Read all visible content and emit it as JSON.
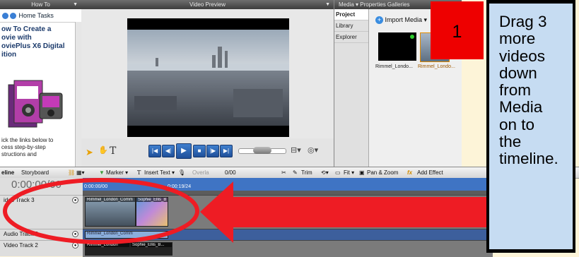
{
  "howto": {
    "title": "How To",
    "nav": "Home  Tasks",
    "heading_lines": [
      "ow To Create a",
      "ovie with",
      "oviePlus X6 Digital",
      "ition"
    ],
    "body_lines": [
      "ick the links below to",
      "cess step-by-step",
      "structions and"
    ]
  },
  "preview": {
    "title": "Video Preview"
  },
  "media": {
    "tabs": "Media ▾  Properties  Galleries",
    "side_items": [
      "Project",
      "Library",
      "Explorer"
    ],
    "import_label": "Import Media ▾",
    "thumb1_label": "Rimmel_Londo...",
    "thumb2_label": "Rimmel_Londo..."
  },
  "timeline": {
    "tab_timeline": "eline",
    "tab_storyboard": "Storyboard",
    "marker": "Marker ▾",
    "insert_text": "Insert Text ▾",
    "overlay": "Overla",
    "overlay_time": "0/00",
    "trim": "Trim",
    "fit": "Fit ▾",
    "pan_zoom": "Pan & Zoom",
    "add_effect": "Add Effect",
    "timecode": "0:00:00/00",
    "ruler_start": "0:00:00/00",
    "ruler_mark": "0:00:19/24",
    "tracks": [
      {
        "name": "ideo Track 3"
      },
      {
        "name": "Audio Track 3"
      },
      {
        "name": "Video Track 2"
      }
    ],
    "clip_a": "Rimmel_London_Comm",
    "clip_b": "Sophie_Ellis_B",
    "audio_clip": "Rimmel_London_Comm",
    "track2_clip_a": "Rimmel_London",
    "track2_clip_b": "Sophie_Ellis_B..."
  },
  "overlay": {
    "number": "1",
    "instruction_lines": [
      "Drag 3",
      "more",
      "videos",
      "down",
      "from",
      "Media",
      "on to",
      "the",
      "timeline."
    ]
  },
  "colors": {
    "arrow": "#ee1c24",
    "instruction_bg": "#c6dcf2",
    "number_bg": "#ee0000",
    "ruler": "#3f74c4"
  }
}
